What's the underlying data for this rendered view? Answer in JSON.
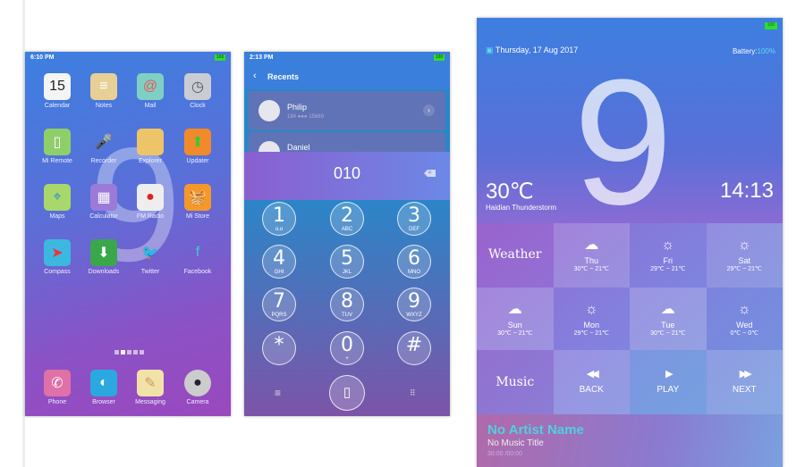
{
  "home": {
    "time": "6:10 PM",
    "battery": "100",
    "apps": [
      {
        "label": "Calendar",
        "icon": "calendar-icon",
        "glyph": "15",
        "bg": "#f4f4f4",
        "fg": "#222"
      },
      {
        "label": "Notes",
        "icon": "notes-icon",
        "glyph": "≡",
        "bg": "#e8cf96",
        "fg": "#fff"
      },
      {
        "label": "Mail",
        "icon": "mail-icon",
        "glyph": "@",
        "bg": "#7fd0c4",
        "fg": "#e55"
      },
      {
        "label": "Clock",
        "icon": "clock-icon",
        "glyph": "◷",
        "bg": "#c9ccd2",
        "fg": "#555"
      },
      {
        "label": "Mi Remote",
        "icon": "remote-icon",
        "glyph": "▯",
        "bg": "#8fcf6a",
        "fg": "#fff"
      },
      {
        "label": "Recorder",
        "icon": "microphone-icon",
        "glyph": "🎤",
        "bg": "transparent",
        "fg": "#ddd"
      },
      {
        "label": "Explorer",
        "icon": "folder-icon",
        "glyph": "▬",
        "bg": "#edc467",
        "fg": "#edc467"
      },
      {
        "label": "Updater",
        "icon": "updater-icon",
        "glyph": "⬆",
        "bg": "#f08a2a",
        "fg": "#3c3"
      },
      {
        "label": "Maps",
        "icon": "map-icon",
        "glyph": "⌖",
        "bg": "#a8d86a",
        "fg": "#2a8ad8"
      },
      {
        "label": "Calculator",
        "icon": "calculator-icon",
        "glyph": "▦",
        "bg": "#9b7ad8",
        "fg": "#fff"
      },
      {
        "label": "FM Radio",
        "icon": "radio-icon",
        "glyph": "●",
        "bg": "#eee",
        "fg": "#d22"
      },
      {
        "label": "Mi Store",
        "icon": "basket-icon",
        "glyph": "🧺",
        "bg": "#f5982a",
        "fg": "#fff"
      },
      {
        "label": "Compass",
        "icon": "compass-icon",
        "glyph": "➤",
        "bg": "#3cb8e0",
        "fg": "#e33"
      },
      {
        "label": "Downloads",
        "icon": "downloads-icon",
        "glyph": "⬇",
        "bg": "#3aa84a",
        "fg": "#fff"
      },
      {
        "label": "Twitter",
        "icon": "twitter-icon",
        "glyph": "🐦",
        "bg": "transparent",
        "fg": "#45b8f0"
      },
      {
        "label": "Facebook",
        "icon": "facebook-icon",
        "glyph": "f",
        "bg": "transparent",
        "fg": "#3cc8d8"
      }
    ],
    "page_indicator": {
      "pages": 5,
      "current": 2
    },
    "dock": [
      {
        "label": "Phone",
        "icon": "phone-icon",
        "glyph": "✆",
        "bg": "#e070a8",
        "fg": "#fff"
      },
      {
        "label": "Browser",
        "icon": "browser-icon",
        "glyph": "◐",
        "bg": "#2aa8e0",
        "fg": "#fff"
      },
      {
        "label": "Messaging",
        "icon": "messaging-icon",
        "glyph": "✎",
        "bg": "#f3e2a8",
        "fg": "#c96"
      },
      {
        "label": "Camera",
        "icon": "camera-icon",
        "glyph": "●",
        "bg": "#ccc",
        "fg": "#223"
      }
    ]
  },
  "dialer": {
    "time": "2:13 PM",
    "battery": "100",
    "title": "Recents",
    "contacts": [
      {
        "name": "Philip",
        "number": "184 ●●● 15689"
      },
      {
        "name": "Daniel",
        "number": ""
      }
    ],
    "entered": "010",
    "keys": [
      {
        "d": "1",
        "l": "o.o"
      },
      {
        "d": "2",
        "l": "ABC"
      },
      {
        "d": "3",
        "l": "DEF"
      },
      {
        "d": "4",
        "l": "GHI"
      },
      {
        "d": "5",
        "l": "JKL"
      },
      {
        "d": "6",
        "l": "MNO"
      },
      {
        "d": "7",
        "l": "PQRS"
      },
      {
        "d": "8",
        "l": "TUV"
      },
      {
        "d": "9",
        "l": "WXYZ"
      },
      {
        "d": "*",
        "l": ""
      },
      {
        "d": "0",
        "l": "+"
      },
      {
        "d": "#",
        "l": ""
      }
    ]
  },
  "launcher": {
    "battery": "100",
    "date": "Thursday, 17 Aug 2017",
    "battery_label": "Battery:",
    "battery_value": "100%",
    "temperature": "30℃",
    "location": "Haidian Thunderstorm",
    "clock": "14:13",
    "big_digit": "9",
    "weather_label": "Weather",
    "forecast": [
      {
        "day": "Thu",
        "range": "30℃ ~ 21℃",
        "icon": "rain-cloud-icon"
      },
      {
        "day": "Fri",
        "range": "29℃ ~ 21℃",
        "icon": "sun-icon"
      },
      {
        "day": "Sat",
        "range": "29℃ ~ 21℃",
        "icon": "sun-icon"
      },
      {
        "day": "Sun",
        "range": "30℃ ~ 21℃",
        "icon": "rain-cloud-icon"
      },
      {
        "day": "Mon",
        "range": "29℃ ~ 21℃",
        "icon": "sun-icon"
      },
      {
        "day": "Tue",
        "range": "30℃ ~ 21℃",
        "icon": "rain-cloud-icon"
      },
      {
        "day": "Wed",
        "range": "0℃ ~ 0℃",
        "icon": "sun-icon"
      }
    ],
    "music_label": "Music",
    "back": "BACK",
    "play": "PLAY",
    "next": "NEXT",
    "artist": "No Artist Name",
    "title": "No Music Title",
    "elapsed": "30:00",
    "total": "00:00",
    "accent": "#4fd0e0"
  }
}
